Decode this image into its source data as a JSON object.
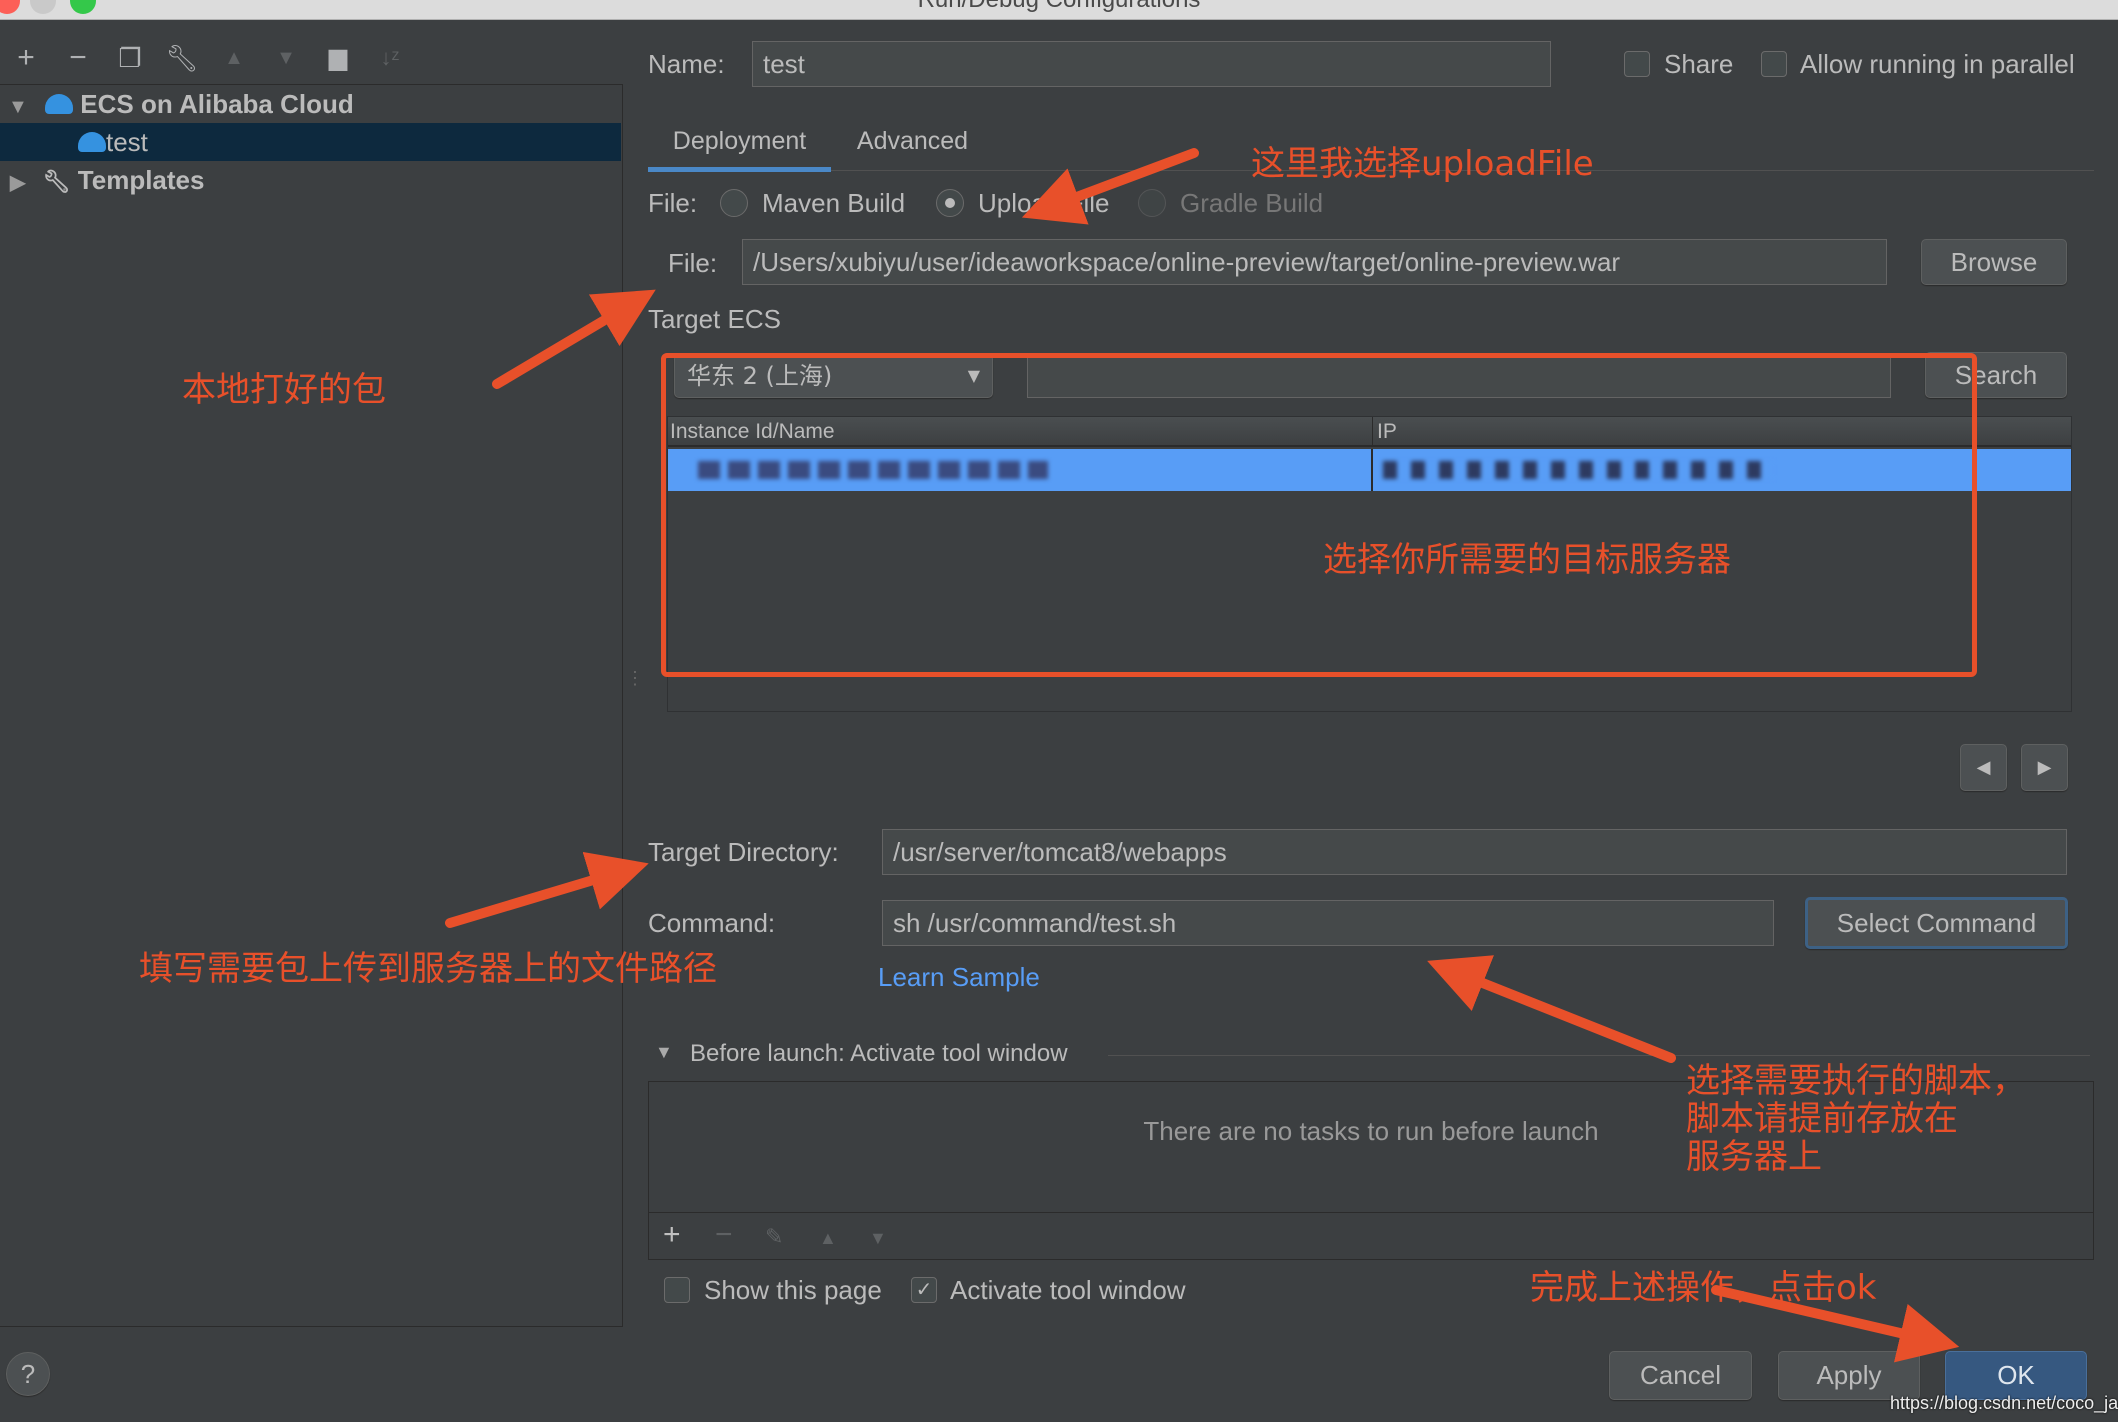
{
  "window": {
    "title": "Run/Debug Configurations"
  },
  "toolbar": {
    "icons": [
      "add-icon",
      "remove-icon",
      "copy-icon",
      "wrench-icon",
      "move-up-icon",
      "move-down-icon",
      "new-folder-icon",
      "sort-icon"
    ]
  },
  "tree": {
    "items": [
      {
        "label": "ECS on Alibaba Cloud",
        "expanded": true
      },
      {
        "label": "test",
        "selected": true
      },
      {
        "label": "Templates",
        "expanded": false
      }
    ]
  },
  "name": {
    "label": "Name:",
    "value": "test"
  },
  "share": {
    "label": "Share",
    "checked": false
  },
  "parallel": {
    "label": "Allow running in parallel",
    "checked": false
  },
  "tabs": [
    {
      "label": "Deployment",
      "active": true
    },
    {
      "label": "Advanced"
    }
  ],
  "file_type": {
    "label": "File:",
    "options": [
      "Maven Build",
      "Upload File",
      "Gradle Build"
    ],
    "selected": "Upload File"
  },
  "file": {
    "label": "File:",
    "value": "/Users/xubiyu/user/ideaworkspace/online-preview/target/online-preview.war",
    "browse": "Browse"
  },
  "target_ecs": {
    "label": "Target ECS",
    "region": "华东 2 (上海)",
    "search_value": "",
    "search_button": "Search",
    "columns": [
      "Instance Id/Name",
      "IP"
    ]
  },
  "target_dir": {
    "label": "Target Directory:",
    "value": "/usr/server/tomcat8/webapps"
  },
  "command": {
    "label": "Command:",
    "value": "sh /usr/command/test.sh",
    "select_button": "Select Command",
    "learn_link": "Learn Sample"
  },
  "before_launch": {
    "title": "Before launch: Activate tool window",
    "empty": "There are no tasks to run before launch"
  },
  "options": {
    "show_page": {
      "label": "Show this page",
      "checked": false
    },
    "activate": {
      "label": "Activate tool window",
      "checked": true
    }
  },
  "buttons": {
    "cancel": "Cancel",
    "apply": "Apply",
    "ok": "OK",
    "help": "?"
  },
  "watermark": "https://blog.csdn.net/coco_jack",
  "annotations": {
    "upload": "这里我选择uploadFile",
    "local_pkg": "本地打好的包",
    "target_server": "选择你所需要的目标服务器",
    "path": "填写需要包上传到服务器上的文件路径",
    "script": [
      "选择需要执行的脚本，",
      "脚本请提前存放在",
      "服务器上"
    ],
    "finish": "完成上述操作，点击ok",
    "color": "#e8502a"
  },
  "colors": {
    "background": "#3c3f41",
    "selection": "#589df6",
    "ok_button": "#365880",
    "link": "#589df6"
  }
}
